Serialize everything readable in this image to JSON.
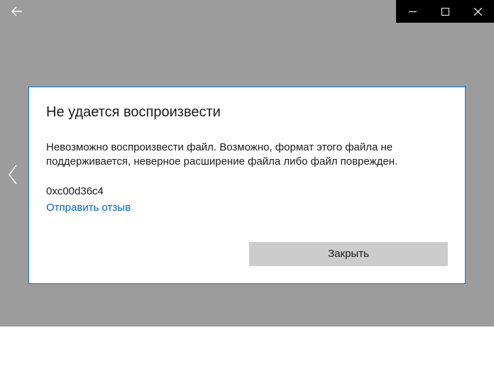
{
  "title_bar": {
    "back_label": "Back",
    "minimize_label": "Minimize",
    "maximize_label": "Maximize",
    "close_label": "Close"
  },
  "nav": {
    "prev_label": "Previous"
  },
  "dialog": {
    "title": "Не удается воспроизвести",
    "message": "Невозможно воспроизвести файл. Возможно, формат этого файла не поддерживается, неверное расширение файла либо файл поврежден.",
    "error_code": "0xc00d36c4",
    "send_feedback": "Отправить отзыв",
    "close_button": "Закрыть"
  }
}
